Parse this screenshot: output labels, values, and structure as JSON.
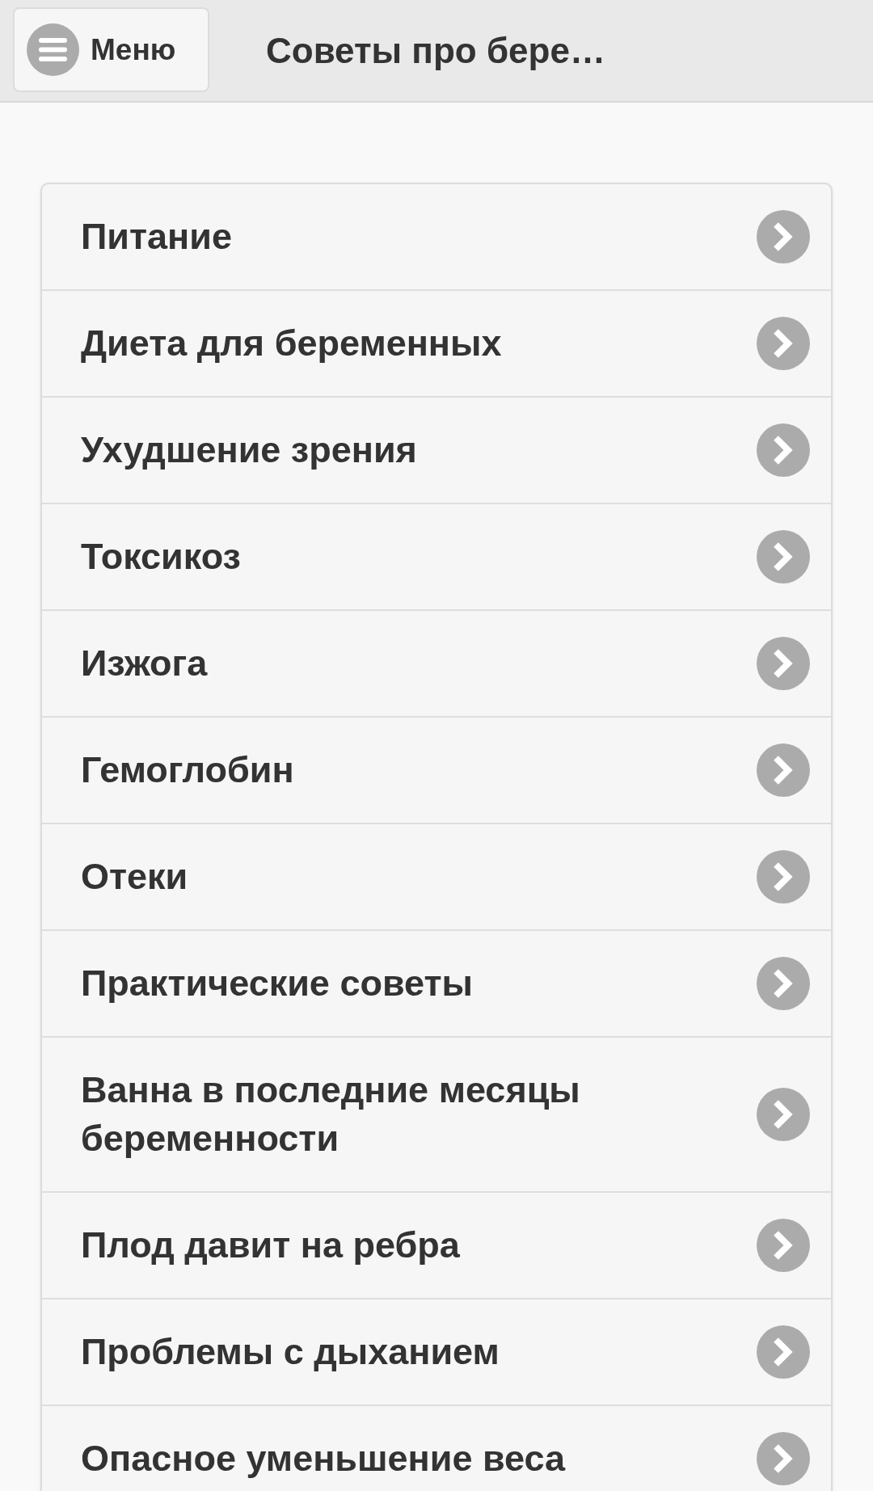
{
  "header": {
    "menu_button": {
      "label": "Меню"
    },
    "title": "Советы про бере…"
  },
  "items": [
    {
      "label": "Питание"
    },
    {
      "label": "Диета для беременных"
    },
    {
      "label": "Ухудшение зрения"
    },
    {
      "label": "Токсикоз"
    },
    {
      "label": "Изжога"
    },
    {
      "label": "Гемоглобин"
    },
    {
      "label": "Отеки"
    },
    {
      "label": "Практические советы"
    },
    {
      "label": "Ванна в последние месяцы беременности"
    },
    {
      "label": "Плод давит на ребра"
    },
    {
      "label": "Проблемы с дыханием"
    },
    {
      "label": "Опасное уменьшение веса"
    }
  ]
}
